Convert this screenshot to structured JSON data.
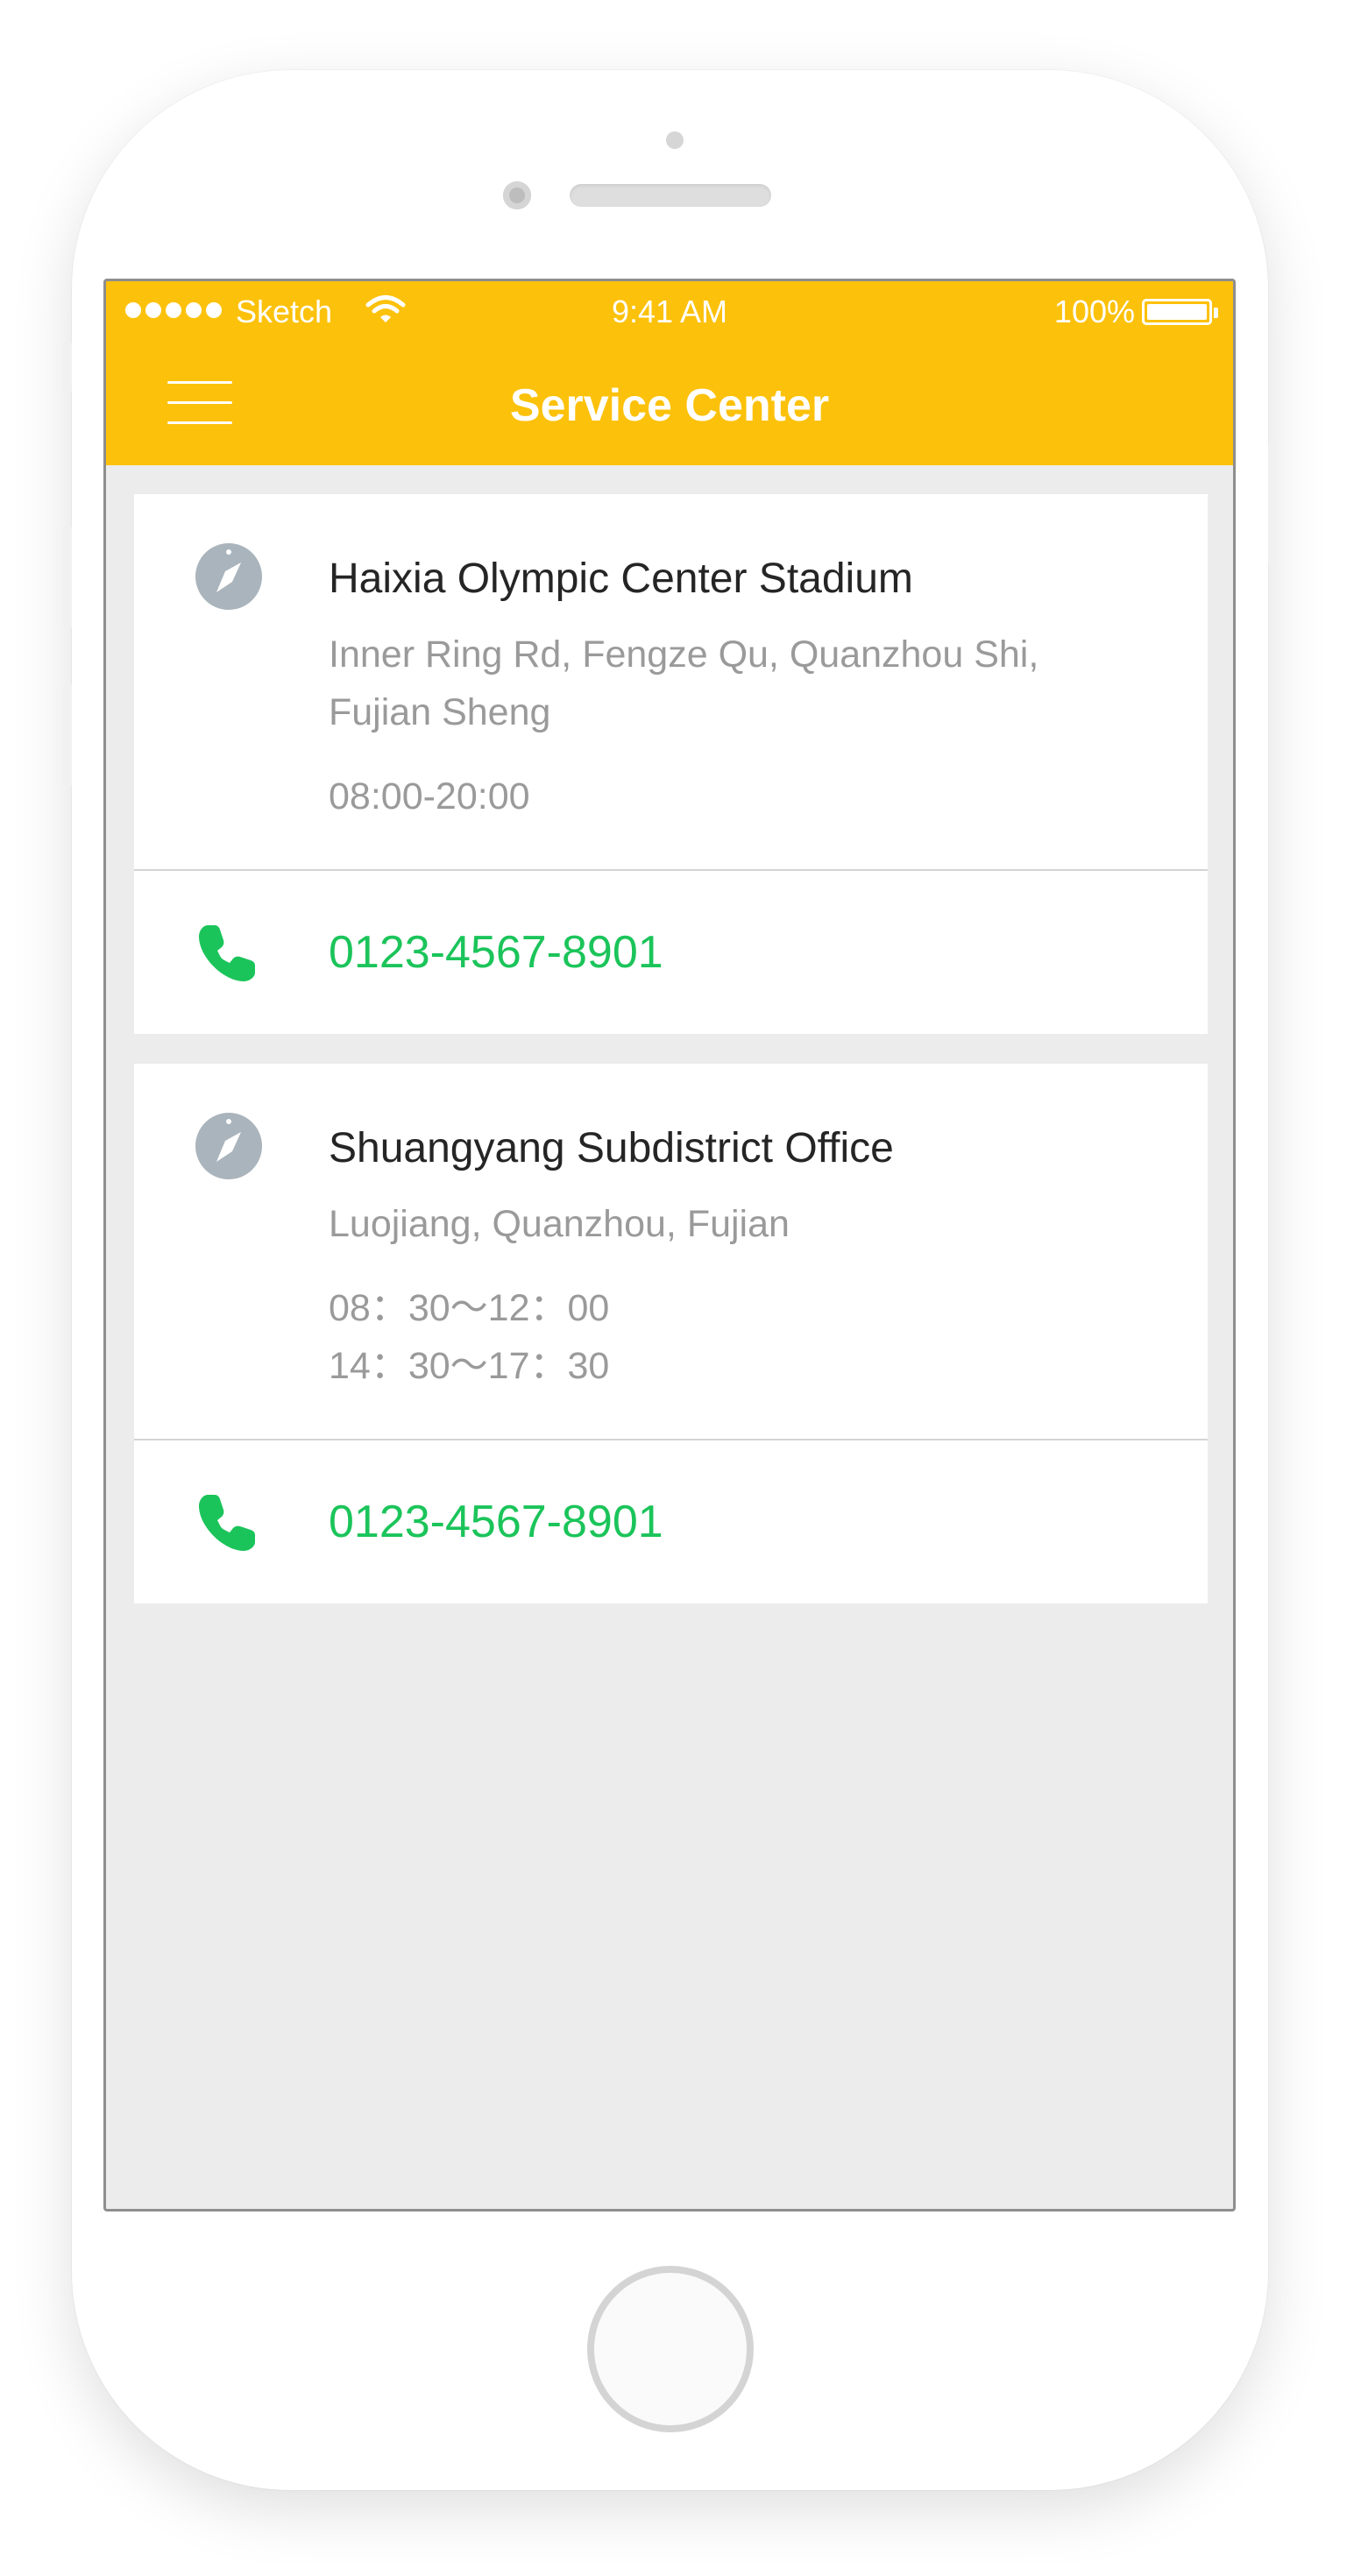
{
  "status_bar": {
    "carrier": "Sketch",
    "time": "9:41 AM",
    "battery": "100%"
  },
  "navbar": {
    "title": "Service Center",
    "menu_icon": "hamburger-menu-icon"
  },
  "locations": [
    {
      "name": "Haixia Olympic Center Stadium",
      "address_lines": [
        "Inner Ring Rd, Fengze Qu, Quanzhou Shi,",
        "Fujian Sheng"
      ],
      "hours": [
        "08:00-20:00"
      ],
      "phone": "0123-4567-8901"
    },
    {
      "name": "Shuangyang Subdistrict Office",
      "address_lines": [
        "Luojiang, Quanzhou, Fujian"
      ],
      "hours": [
        "08：30～12：00",
        "14：30～17：30"
      ],
      "phone": "0123-4567-8901"
    }
  ],
  "colors": {
    "accent": "#fcc10a",
    "phone_green": "#1bc45a",
    "icon_gray": "#aab4bc",
    "background": "#ececec"
  },
  "icons": {
    "location": "compass-icon",
    "phone": "phone-icon"
  }
}
